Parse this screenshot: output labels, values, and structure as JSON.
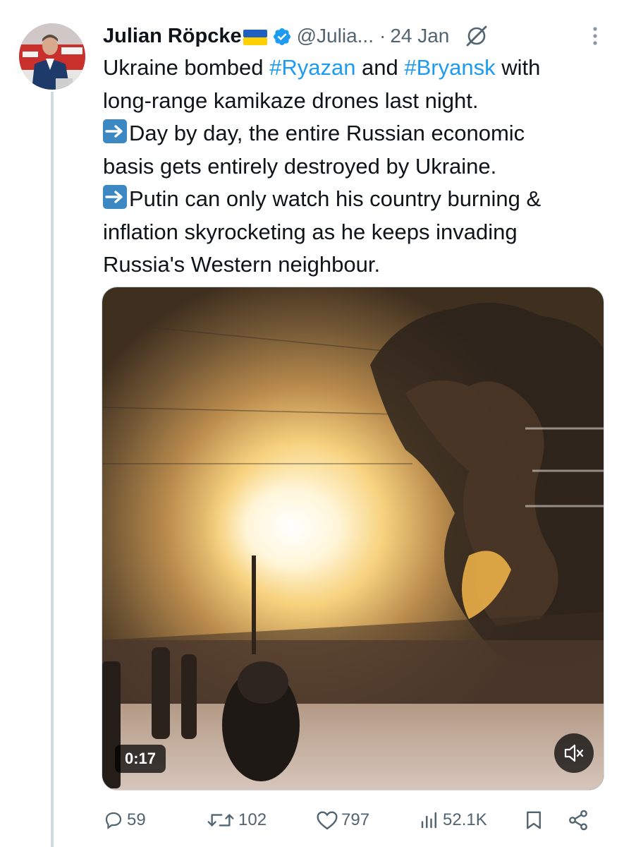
{
  "author": {
    "name": "Julian Röpcke",
    "handle": "@Julia...",
    "separator": "·",
    "date": "24 Jan"
  },
  "tweet": {
    "lines": [
      [
        {
          "text": "Ukraine bombed "
        },
        {
          "text": "#Ryazan",
          "tag": true
        },
        {
          "text": " and "
        },
        {
          "text": "#Bryansk",
          "tag": true
        },
        {
          "text": " with"
        }
      ],
      [
        {
          "text": "long-range kamikaze drones last night."
        }
      ],
      [
        {
          "text": "Day by day, the entire Russian economic",
          "arrow": true
        }
      ],
      [
        {
          "text": "basis gets entirely destroyed by Ukraine."
        }
      ],
      [
        {
          "text": "Putin can only watch his country burning &",
          "arrow": true
        }
      ],
      [
        {
          "text": "inflation skyrocketing as he keeps invading"
        }
      ],
      [
        {
          "text": "Russia's Western neighbour."
        }
      ]
    ]
  },
  "media": {
    "duration": "0:17",
    "mute_icon": "speaker-muted-icon"
  },
  "actions": {
    "replies": "59",
    "reposts": "102",
    "likes": "797",
    "views": "52.1K"
  },
  "icons": {
    "verified": "verified-badge-icon",
    "grok": "grok-icon",
    "more": "more-vertical-icon",
    "reply": "reply-icon",
    "repost": "repost-icon",
    "like": "heart-icon",
    "views": "views-icon",
    "bookmark": "bookmark-icon",
    "share": "share-icon"
  },
  "colors": {
    "hashtag": "#1d9bf0",
    "verified": "#1d9bf0",
    "secondary_text": "#536471",
    "thread_line": "#cfd9de"
  }
}
